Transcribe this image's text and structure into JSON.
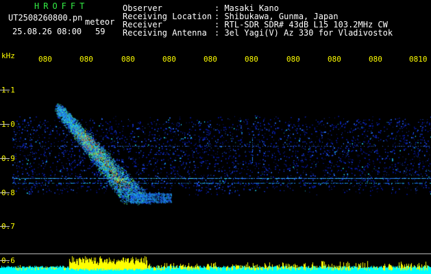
{
  "header": {
    "brand": "HROFFT",
    "filename": "UT2508260800.pn",
    "filename_suffix": "meteor",
    "timestamp": "25.08.26 08:00",
    "counter": "59",
    "info_labels": [
      "Observer",
      "Receiving Location",
      "Receiver",
      "Receiving Antenna"
    ],
    "info_values": [
      ": Masaki Kano",
      ": Shibukawa, Gunma, Japan",
      ": RTL-SDR SDR# 43dB L15 103.2MHz CW",
      ": 3el Yagi(V) Az 330 for Vladivostok"
    ]
  },
  "time_axis": {
    "labels": [
      "080",
      "080",
      "080",
      "080",
      "080",
      "080",
      "080",
      "080",
      "080",
      "0810"
    ]
  },
  "freq_axis": {
    "unit": "kHz",
    "labels": [
      "1.1",
      "1.0",
      "0.9",
      "0.8",
      "0.7",
      "0.6"
    ]
  },
  "colors": {
    "background": "#000000",
    "header_text": "#ffffff",
    "brand": "#33ee44",
    "axis_labels": "#ffff00",
    "baseline_cyan": "#00ffff",
    "noise_blue": "#0000c8"
  }
}
